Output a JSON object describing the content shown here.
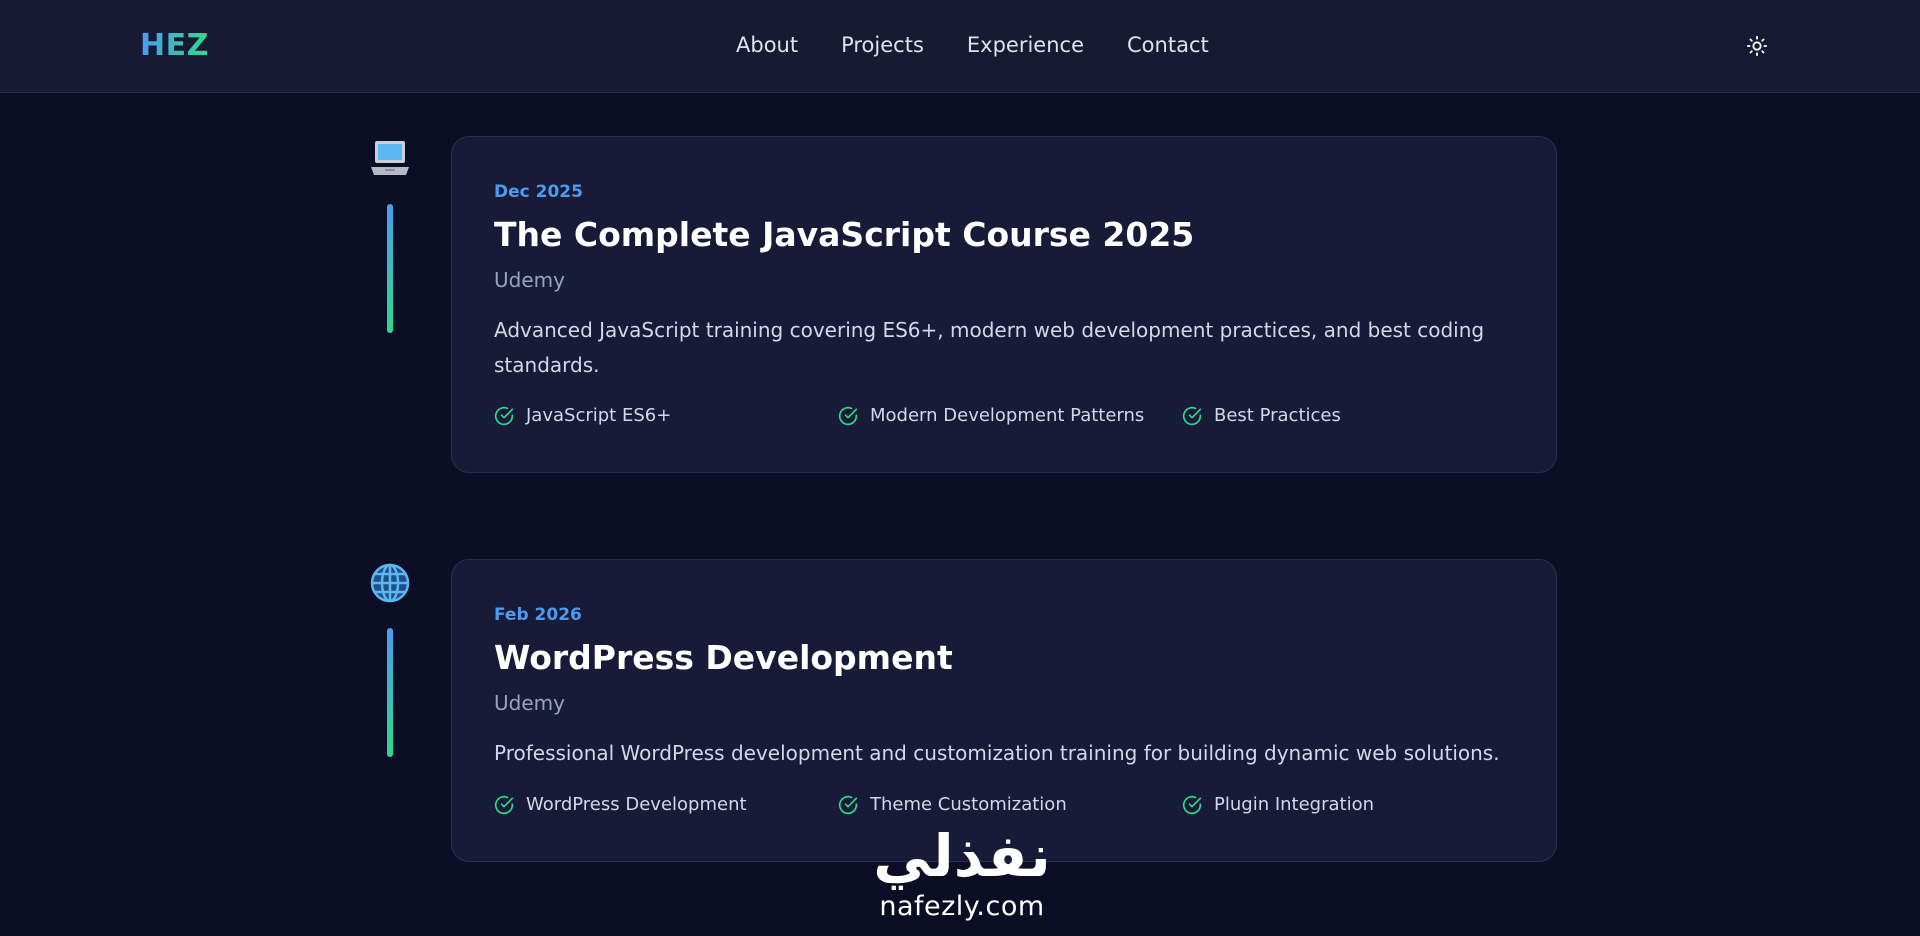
{
  "nav": {
    "logo": "HEZ",
    "links": [
      "About",
      "Projects",
      "Experience",
      "Contact"
    ],
    "theme_toggle_icon": "sun-icon"
  },
  "timeline": [
    {
      "icon": "laptop-icon",
      "date": "Dec 2025",
      "title": "The Complete JavaScript Course 2025",
      "org": "Udemy",
      "description": "Advanced JavaScript training covering ES6+, modern web development practices, and best coding standards.",
      "tags": [
        "JavaScript ES6+",
        "Modern Development Patterns",
        "Best Practices"
      ]
    },
    {
      "icon": "globe-icon",
      "date": "Feb 2026",
      "title": "WordPress Development",
      "org": "Udemy",
      "description": "Professional WordPress development and customization training for building dynamic web solutions.",
      "tags": [
        "WordPress Development",
        "Theme Customization",
        "Plugin Integration"
      ]
    }
  ],
  "watermark": {
    "arabic": "نفذلي",
    "latin": "nafezly.com"
  },
  "colors": {
    "accent_blue": "#4d9bf0",
    "accent_green": "#2fd98a",
    "background": "#0b0e24",
    "card": "#181b37"
  }
}
